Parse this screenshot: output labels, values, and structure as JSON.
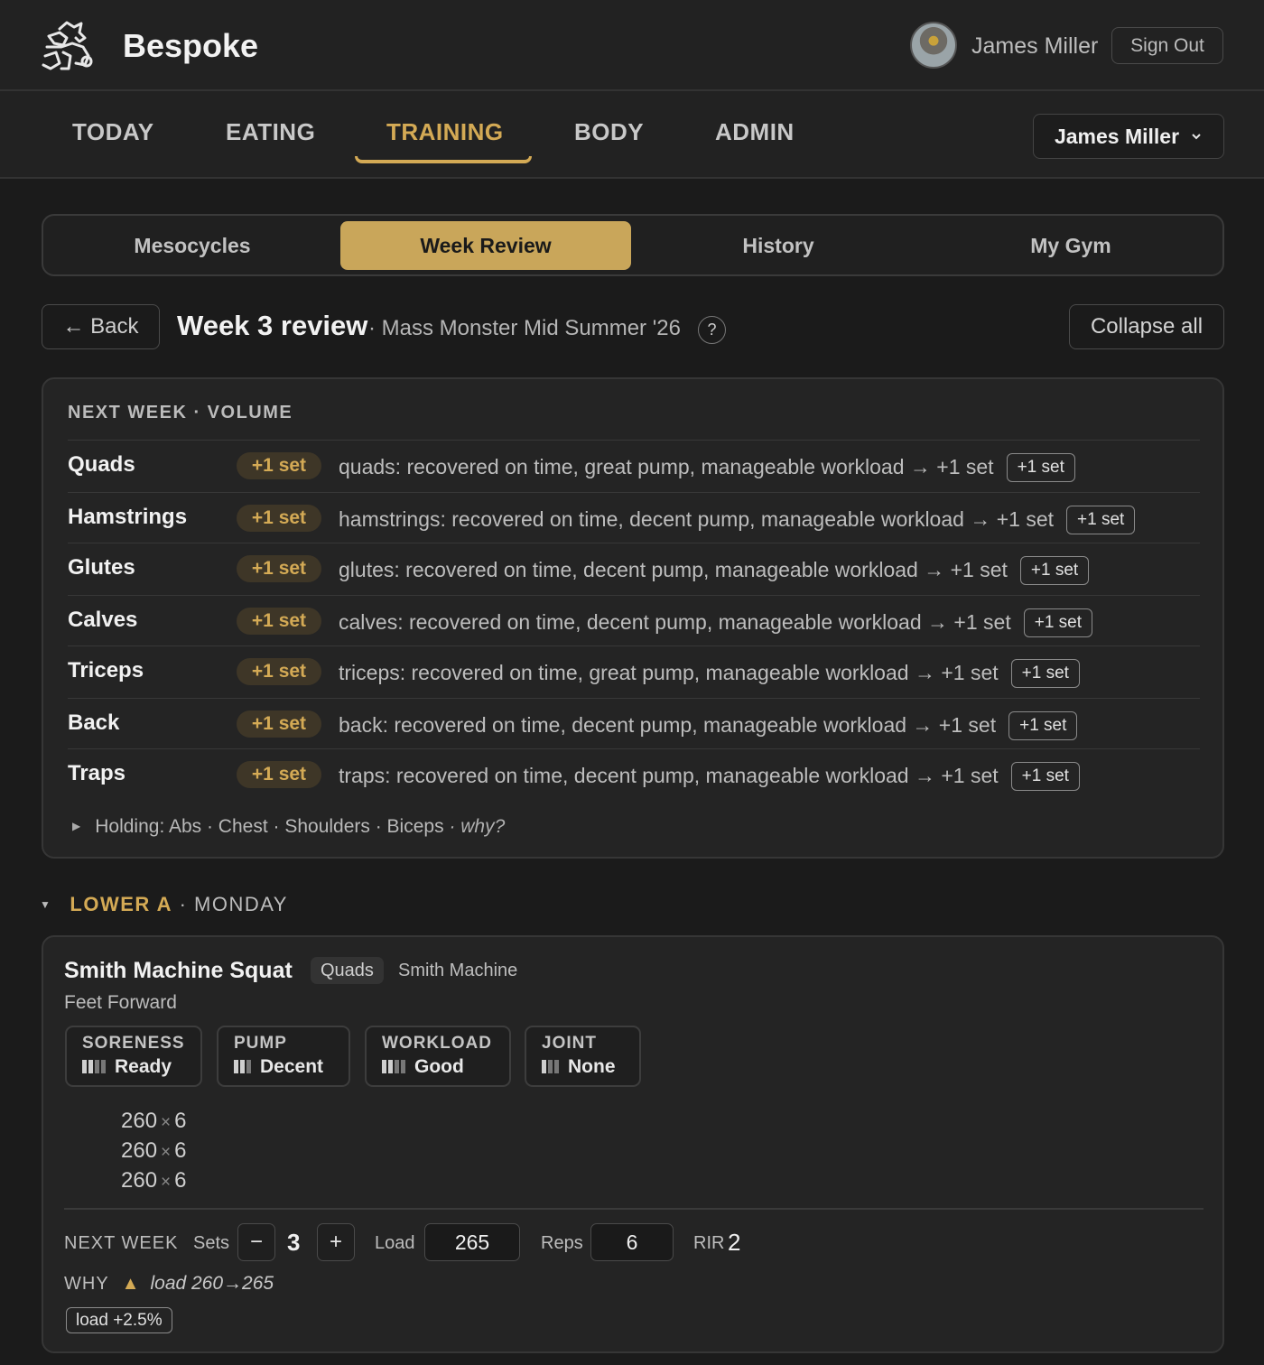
{
  "header": {
    "brand": "Bespoke",
    "user_name": "James Miller",
    "signout_label": "Sign Out"
  },
  "nav": {
    "items": [
      "TODAY",
      "EATING",
      "TRAINING",
      "BODY",
      "ADMIN"
    ],
    "active": "TRAINING",
    "user_select": "James Miller"
  },
  "subtabs": {
    "items": [
      "Mesocycles",
      "Week Review",
      "History",
      "My Gym"
    ],
    "active": "Week Review"
  },
  "page": {
    "back_label": "← Back",
    "title": "Week 3 review",
    "subtitle": "· Mass Monster Mid Summer '26",
    "help": "?",
    "collapse_label": "Collapse all"
  },
  "volume": {
    "heading": "NEXT WEEK · VOLUME",
    "rows": [
      {
        "muscle": "Quads",
        "pill": "+1 set",
        "text": "quads: recovered on time, great pump, manageable workload → +1 set",
        "chip": "+1 set"
      },
      {
        "muscle": "Hamstrings",
        "pill": "+1 set",
        "text": "hamstrings: recovered on time, decent pump, manageable workload → +1 set",
        "chip": "+1 set"
      },
      {
        "muscle": "Glutes",
        "pill": "+1 set",
        "text": "glutes: recovered on time, decent pump, manageable workload → +1 set",
        "chip": "+1 set"
      },
      {
        "muscle": "Calves",
        "pill": "+1 set",
        "text": "calves: recovered on time, decent pump, manageable workload → +1 set",
        "chip": "+1 set"
      },
      {
        "muscle": "Triceps",
        "pill": "+1 set",
        "text": "triceps: recovered on time, great pump, manageable workload → +1 set",
        "chip": "+1 set"
      },
      {
        "muscle": "Back",
        "pill": "+1 set",
        "text": "back: recovered on time, decent pump, manageable workload → +1 set",
        "chip": "+1 set"
      },
      {
        "muscle": "Traps",
        "pill": "+1 set",
        "text": "traps: recovered on time, decent pump, manageable workload → +1 set",
        "chip": "+1 set"
      }
    ],
    "holding": "Holding: Abs · Chest · Shoulders · Biceps",
    "why": "· why?"
  },
  "section": {
    "name": "LOWER A",
    "sep": "·",
    "day": "MONDAY"
  },
  "exercise": {
    "title": "Smith Machine Squat",
    "tag": "Quads",
    "equipment": "Smith Machine",
    "variant": "Feet Forward",
    "metrics": [
      {
        "label": "SORENESS",
        "value": "Ready",
        "level": 2,
        "max": 3
      },
      {
        "label": "PUMP",
        "value": "Decent",
        "level": 2,
        "max": 3
      },
      {
        "label": "WORKLOAD",
        "value": "Good",
        "level": 2,
        "max": 3
      },
      {
        "label": "JOINT",
        "value": "None",
        "level": 1,
        "max": 3
      }
    ],
    "sets": [
      {
        "load": "260",
        "x": "×",
        "reps": "6"
      },
      {
        "load": "260",
        "x": "×",
        "reps": "6"
      },
      {
        "load": "260",
        "x": "×",
        "reps": "6"
      }
    ],
    "next_week": {
      "label": "NEXT WEEK",
      "sets_label": "Sets",
      "minus": "−",
      "sets_value": "3",
      "plus": "+",
      "load_label": "Load",
      "load_value": "265",
      "reps_label": "Reps",
      "reps_value": "6",
      "rir_label": "RIR",
      "rir_value": "2"
    },
    "why": {
      "label": "WHY",
      "icon": "▲",
      "text": "load 260→265",
      "chip": "load +2.5%"
    }
  },
  "colors": {
    "accent": "#d4aa55",
    "background": "#1b1b1b",
    "card": "#242424"
  }
}
